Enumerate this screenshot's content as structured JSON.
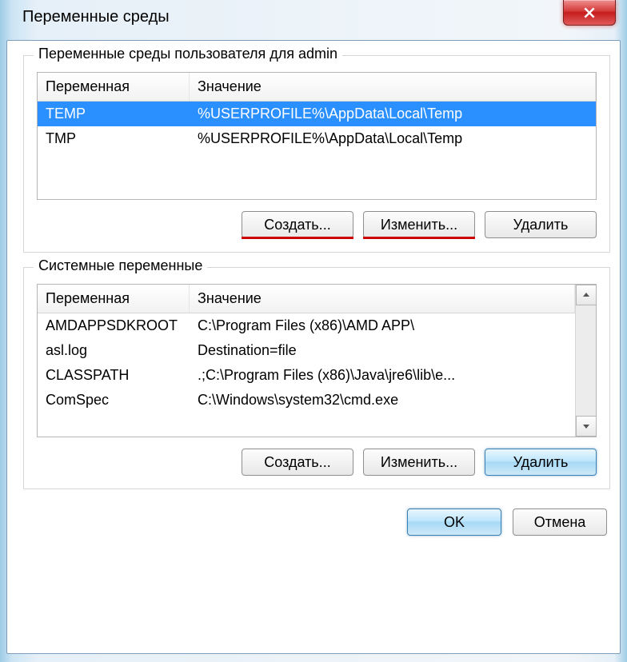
{
  "window": {
    "title": "Переменные среды"
  },
  "userVars": {
    "legend": "Переменные среды пользователя для admin",
    "columns": {
      "name": "Переменная",
      "value": "Значение"
    },
    "rows": [
      {
        "name": "TEMP",
        "value": "%USERPROFILE%\\AppData\\Local\\Temp",
        "selected": true
      },
      {
        "name": "TMP",
        "value": "%USERPROFILE%\\AppData\\Local\\Temp",
        "selected": false
      }
    ],
    "buttons": {
      "create": "Создать...",
      "edit": "Изменить...",
      "delete": "Удалить"
    }
  },
  "sysVars": {
    "legend": "Системные переменные",
    "columns": {
      "name": "Переменная",
      "value": "Значение"
    },
    "rows": [
      {
        "name": "AMDAPPSDKROOT",
        "value": "C:\\Program Files (x86)\\AMD APP\\"
      },
      {
        "name": "asl.log",
        "value": "Destination=file"
      },
      {
        "name": "CLASSPATH",
        "value": ".;C:\\Program Files (x86)\\Java\\jre6\\lib\\e..."
      },
      {
        "name": "ComSpec",
        "value": "C:\\Windows\\system32\\cmd.exe"
      }
    ],
    "buttons": {
      "create": "Создать...",
      "edit": "Изменить...",
      "delete": "Удалить"
    }
  },
  "footer": {
    "ok": "OK",
    "cancel": "Отмена"
  }
}
